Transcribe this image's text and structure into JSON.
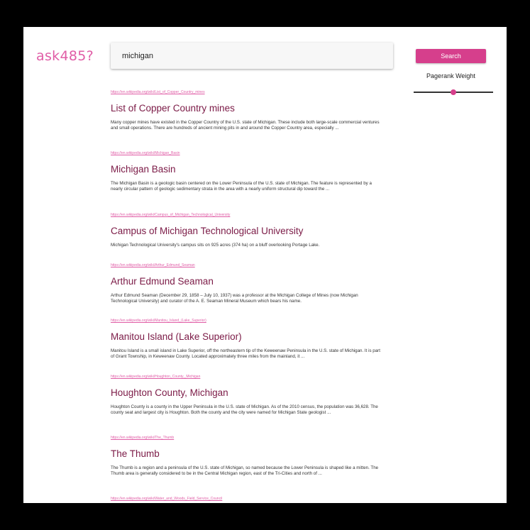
{
  "logo": "ask485?",
  "search": {
    "value": "michigan"
  },
  "search_button": "Search",
  "pagerank": {
    "label": "Pagerank Weight",
    "value": 0.5
  },
  "results": [
    {
      "url": "https://en.wikipedia.org/wiki/List_of_Copper_Country_mines",
      "title": "List of Copper Country mines",
      "snippet": "Many copper mines have existed in the Copper Country of the U.S. state of Michigan. These include both large-scale commercial ventures and small operations. There are hundreds of ancient mining pits in and around the Copper Country area, especially ..."
    },
    {
      "url": "https://en.wikipedia.org/wiki/Michigan_Basin",
      "title": "Michigan Basin",
      "snippet": "The Michigan Basin is a geologic basin centered on the Lower Peninsula of the U.S. state of Michigan. The feature is represented by a nearly circular pattern of geologic sedimentary strata in the area with a nearly uniform structural dip toward the ..."
    },
    {
      "url": "https://en.wikipedia.org/wiki/Campus_of_Michigan_Technological_University",
      "title": "Campus of Michigan Technological University",
      "snippet": "Michigan Technological University's campus sits on 925 acres (374 ha) on a bluff overlooking Portage Lake."
    },
    {
      "url": "https://en.wikipedia.org/wiki/Arthur_Edmund_Seaman",
      "title": "Arthur Edmund Seaman",
      "snippet": "Arthur Edmund Seaman (December 29, 1858 – July 10, 1937) was a professor at the Michigan College of Mines (now Michigan Technological University) and curator of the A. E. Seaman Mineral Museum which bears his name."
    },
    {
      "url": "https://en.wikipedia.org/wiki/Manitou_Island_(Lake_Superior)",
      "title": "Manitou Island (Lake Superior)",
      "snippet": "Manitou Island is a small island in Lake Superior, off the northeastern tip of the Keweenaw Peninsula in the U.S. state of Michigan. It is part of Grant Township, in Keweenaw County. Located approximately three miles from the mainland, it ..."
    },
    {
      "url": "https://en.wikipedia.org/wiki/Houghton_County,_Michigan",
      "title": "Houghton County, Michigan",
      "snippet": "Houghton County is a county in the Upper Peninsula in the U.S. state of Michigan. As of the 2010 census, the population was 36,628. The county seat and largest city is Houghton. Both the county and the city were named for Michigan State geologist ..."
    },
    {
      "url": "https://en.wikipedia.org/wiki/The_Thumb",
      "title": "The Thumb",
      "snippet": "The Thumb is a region and a peninsula of the U.S. state of Michigan, so named because the Lower Peninsula is shaped like a mitten. The Thumb area is generally considered to be in the Central Michigan region, east of the Tri-Cities and north of ..."
    },
    {
      "url": "https://en.wikipedia.org/wiki/Water_and_Woods_Field_Service_Council",
      "title": "",
      "snippet": ""
    }
  ]
}
